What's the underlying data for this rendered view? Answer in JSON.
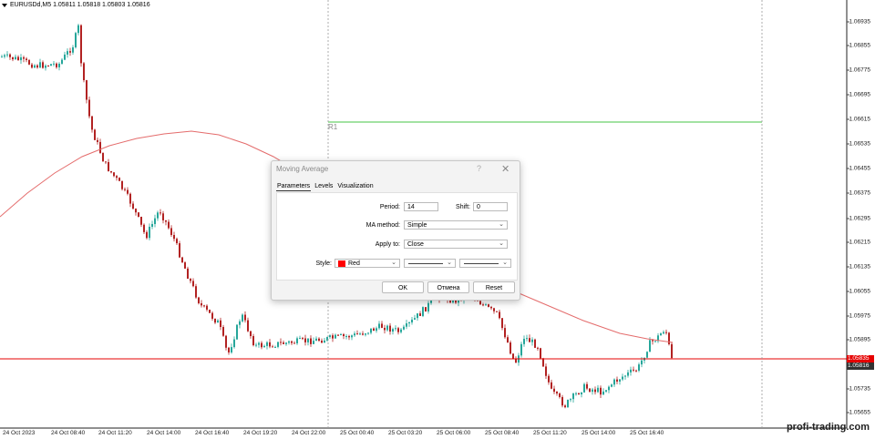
{
  "symbol_header": {
    "text": "EURUSDd,M5  1.05811 1.05818 1.05803 1.05816"
  },
  "price_axis": [
    "1.06935",
    "1.06855",
    "1.06775",
    "1.06695",
    "1.06615",
    "1.06535",
    "1.06455",
    "1.06375",
    "1.06295",
    "1.06215",
    "1.06135",
    "1.06055",
    "1.05975",
    "1.05895",
    "1.05735",
    "1.05655"
  ],
  "time_axis": [
    "24 Oct 2023",
    "24 Oct 08:40",
    "24 Oct 11:20",
    "24 Oct 14:00",
    "24 Oct 16:40",
    "24 Oct 19:20",
    "24 Oct 22:00",
    "25 Oct 00:40",
    "25 Oct 03:20",
    "25 Oct 06:00",
    "25 Oct 08:40",
    "25 Oct 11:20",
    "25 Oct 14:00",
    "25 Oct 16:40"
  ],
  "current_prices": {
    "ask": "1.05835",
    "bid": "1.05816"
  },
  "level_label": "R1",
  "watermark": "profi-trading.com",
  "colors": {
    "bull": "#26a69a",
    "bear": "#b22222",
    "ma_line": "#e46c6c",
    "ask": "#e60000",
    "bid": "#333333",
    "r1_line": "#44c444"
  },
  "dialog": {
    "title": "Moving Average",
    "help": "?",
    "close": "✕",
    "tabs": [
      "Parameters",
      "Levels",
      "Visualization"
    ],
    "active_tab": "Parameters",
    "period_label": "Period:",
    "period_value": "14",
    "shift_label": "Shift:",
    "shift_value": "0",
    "method_label": "MA method:",
    "method_value": "Simple",
    "apply_label": "Apply to:",
    "apply_value": "Close",
    "style_label": "Style:",
    "color_value": "Red",
    "ok_label": "OK",
    "cancel_label": "Отмена",
    "reset_label": "Reset"
  }
}
